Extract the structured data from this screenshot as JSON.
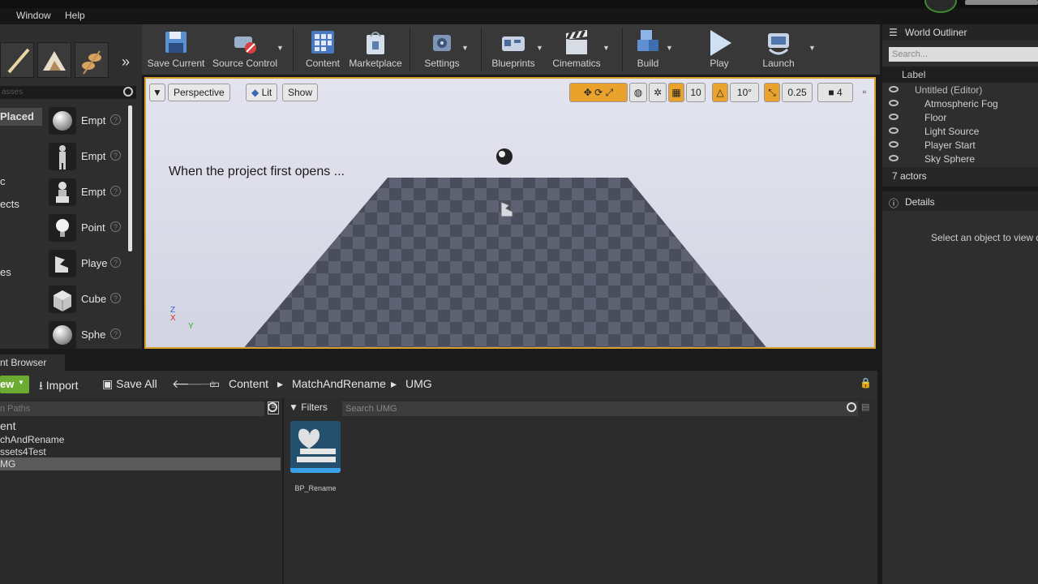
{
  "menu": {
    "items": [
      "Window",
      "Help"
    ]
  },
  "modes": {
    "search_placeholder": "asses",
    "categories": {
      "recent": "Placed",
      "c2": "c",
      "c3": "ects",
      "c4": "es"
    },
    "items": [
      {
        "label": "Empt",
        "icon": "empty-actor-sphere-icon"
      },
      {
        "label": "Empt",
        "icon": "empty-character-icon"
      },
      {
        "label": "Empt",
        "icon": "empty-pawn-icon"
      },
      {
        "label": "Point",
        "icon": "point-light-icon"
      },
      {
        "label": "Playe",
        "icon": "player-start-icon"
      },
      {
        "label": "Cube",
        "icon": "cube-icon"
      },
      {
        "label": "Sphe",
        "icon": "sphere-icon"
      }
    ]
  },
  "toolbar": {
    "save_current": "Save Current",
    "source_control": "Source Control",
    "content": "Content",
    "marketplace": "Marketplace",
    "settings": "Settings",
    "blueprints": "Blueprints",
    "cinematics": "Cinematics",
    "build": "Build",
    "play": "Play",
    "launch": "Launch"
  },
  "viewport": {
    "perspective": "Perspective",
    "lit": "Lit",
    "show": "Show",
    "grid_snap": "10",
    "rotation_snap": "10°",
    "scale_snap": "0.25",
    "camera_speed": "4",
    "caption": "When the project first opens ...",
    "axis_z": "Z",
    "axis_x": "X",
    "axis_y": "Y",
    "colors": {
      "frame": "#d7a02b",
      "orange_tool": "#e9a22b"
    }
  },
  "outliner": {
    "title": "World Outliner",
    "search_placeholder": "Search...",
    "column_label": "Label",
    "rows": [
      "Untitled (Editor)",
      "Atmospheric Fog",
      "Floor",
      "Light Source",
      "Player Start",
      "Sky Sphere"
    ],
    "actor_count": "7 actors"
  },
  "details": {
    "title": "Details",
    "empty_text": "Select an object to view d"
  },
  "content_browser": {
    "tab": "nt Browser",
    "add_new": "ew",
    "import": "Import",
    "save_all": "Save All",
    "breadcrumb": [
      "Content",
      "MatchAndRename",
      "UMG"
    ],
    "paths_placeholder": "n Paths",
    "tree": [
      "ent",
      "chAndRename",
      "ssets4Test",
      "MG"
    ],
    "filters": "Filters",
    "search_placeholder": "Search UMG",
    "assets": [
      {
        "name": "BP_Rename"
      }
    ],
    "colors": {
      "add_button": "#6bab32"
    }
  }
}
